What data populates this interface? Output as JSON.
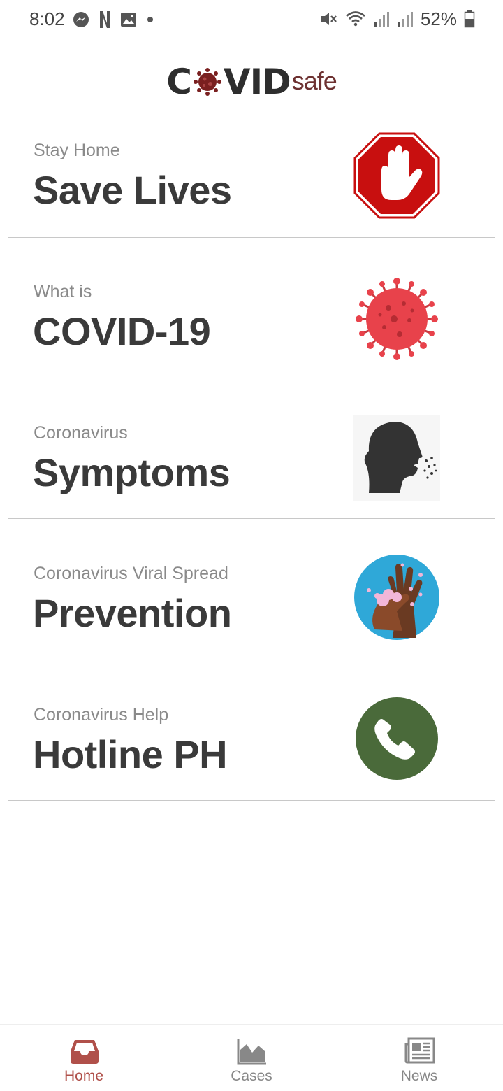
{
  "status_bar": {
    "time": "8:02",
    "battery_percent": "52%",
    "icons": [
      "messenger-icon",
      "netflix-icon",
      "gallery-icon",
      "dot-icon",
      "mute-icon",
      "wifi-icon",
      "signal-icon",
      "signal-icon",
      "battery-icon"
    ]
  },
  "app": {
    "logo_main_left": "C",
    "logo_main_right": "VID",
    "logo_suffix": "safe"
  },
  "colors": {
    "accent": "#b0504a",
    "stop_red": "#c80f0f",
    "virus_red": "#e8424b",
    "phone_green": "#4a6a3a",
    "prevention_blue": "#2fa8d8",
    "text_dark": "#3a3a3a",
    "text_muted": "#8a8a8a"
  },
  "menu": {
    "items": [
      {
        "subtitle": "Stay Home",
        "title": "Save Lives",
        "icon": "stop-hand-icon"
      },
      {
        "subtitle": "What is",
        "title": "COVID-19",
        "icon": "coronavirus-icon"
      },
      {
        "subtitle": "Coronavirus",
        "title": "Symptoms",
        "icon": "coughing-head-icon"
      },
      {
        "subtitle": "Coronavirus Viral Spread",
        "title": "Prevention",
        "icon": "hand-washing-icon"
      },
      {
        "subtitle": "Coronavirus Help",
        "title": "Hotline PH",
        "icon": "phone-icon"
      }
    ]
  },
  "bottom_nav": {
    "items": [
      {
        "label": "Home",
        "icon": "inbox-icon",
        "active": true
      },
      {
        "label": "Cases",
        "icon": "area-chart-icon",
        "active": false
      },
      {
        "label": "News",
        "icon": "newspaper-icon",
        "active": false
      }
    ]
  }
}
